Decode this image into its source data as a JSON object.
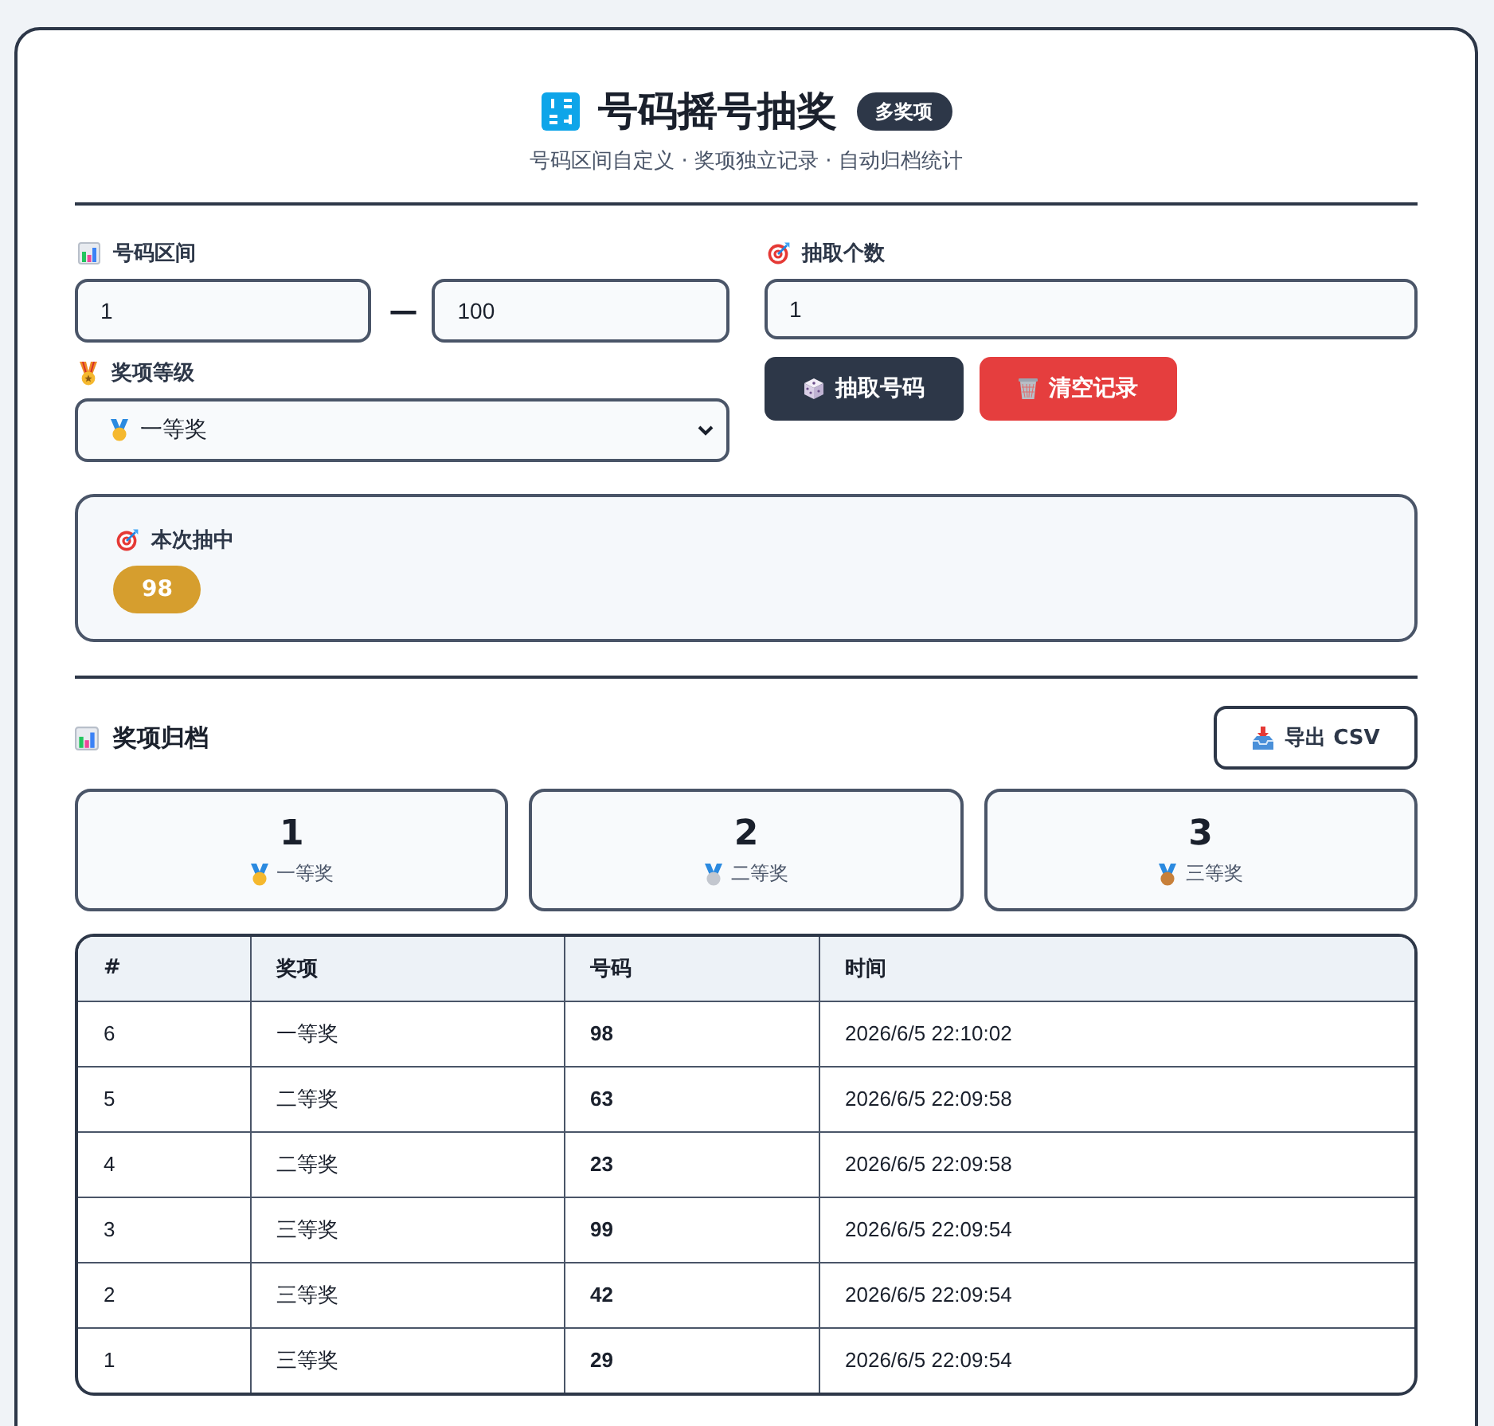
{
  "header": {
    "title": "号码摇号抽奖",
    "badge": "多奖项",
    "subtitle": "号码区间自定义 · 奖项独立记录 · 自动归档统计"
  },
  "range": {
    "label": "号码区间",
    "start": "1",
    "separator": "—",
    "end": "100"
  },
  "prize_level": {
    "label": "奖项等级",
    "value": "一等奖"
  },
  "draw_count": {
    "label": "抽取个数",
    "value": "1"
  },
  "actions": [
    {
      "kind": "draw",
      "label": "抽取号码"
    },
    {
      "kind": "clear",
      "label": "清空记录"
    }
  ],
  "result": {
    "label": "本次抽中",
    "numbers": [
      "98"
    ]
  },
  "archive": {
    "title": "奖项归档",
    "export_button": "导出 CSV",
    "stats": [
      {
        "count": "1",
        "label": "一等奖",
        "color": "#f5b82e"
      },
      {
        "count": "2",
        "label": "二等奖",
        "color": "#c3c7cf"
      },
      {
        "count": "3",
        "label": "三等奖",
        "color": "#c8803a"
      }
    ]
  },
  "table": {
    "columns": [
      "#",
      "奖项",
      "号码",
      "时间"
    ],
    "rows": [
      [
        "6",
        "一等奖",
        "98",
        "2026/6/5 22:10:02"
      ],
      [
        "5",
        "二等奖",
        "63",
        "2026/6/5 22:09:58"
      ],
      [
        "4",
        "二等奖",
        "23",
        "2026/6/5 22:09:58"
      ],
      [
        "3",
        "三等奖",
        "99",
        "2026/6/5 22:09:54"
      ],
      [
        "2",
        "三等奖",
        "42",
        "2026/6/5 22:09:54"
      ],
      [
        "1",
        "三等奖",
        "29",
        "2026/6/5 22:09:54"
      ]
    ]
  }
}
